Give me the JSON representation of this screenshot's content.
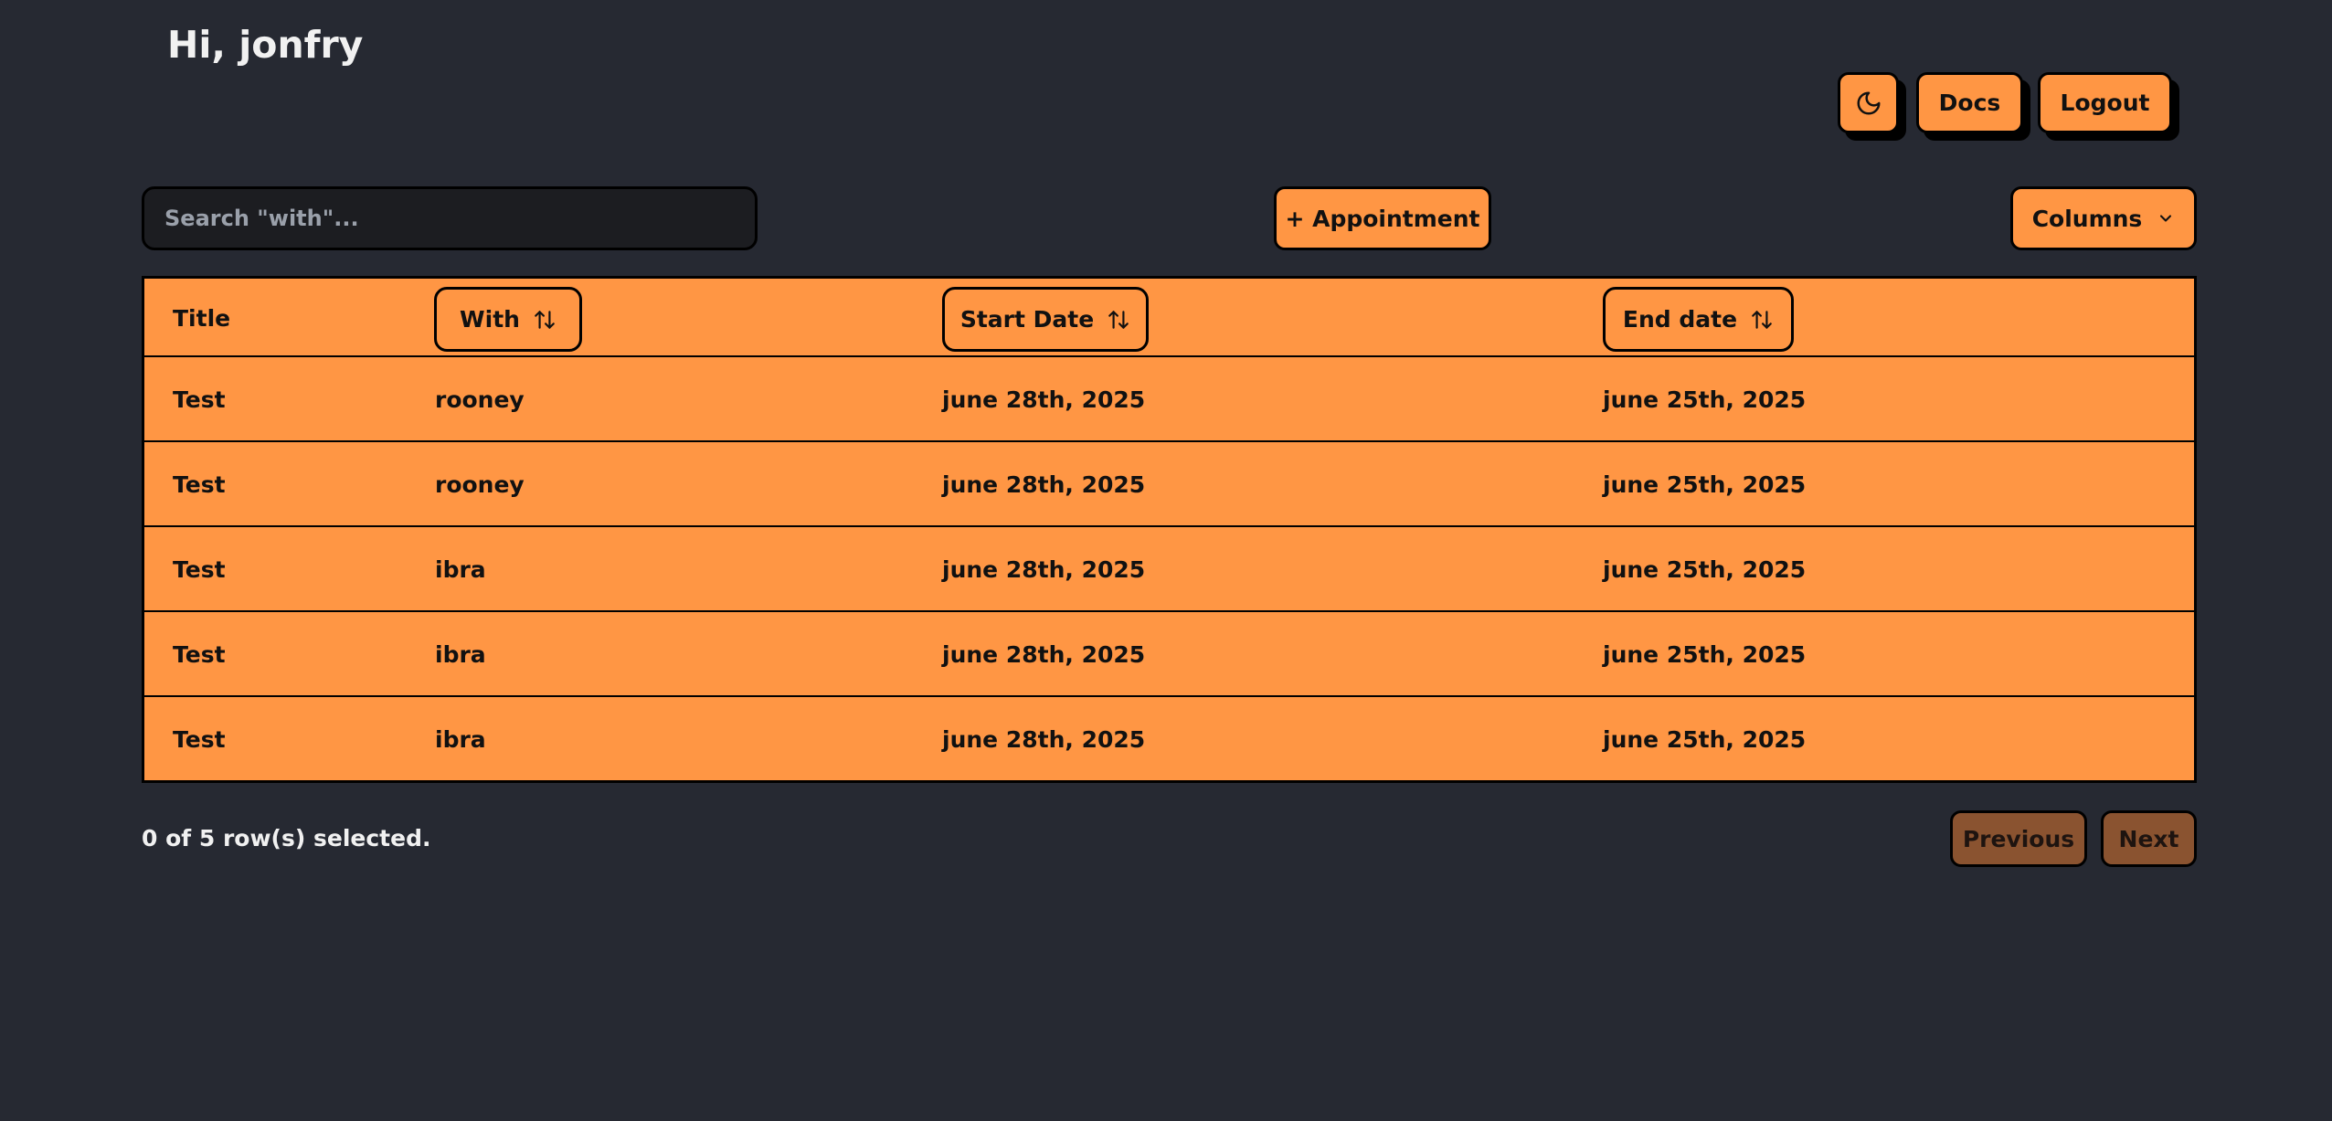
{
  "header": {
    "greeting": "Hi, jonfry",
    "theme_icon": "moon-icon",
    "docs_label": "Docs",
    "logout_label": "Logout"
  },
  "toolbar": {
    "search_placeholder": "Search \"with\"...",
    "search_value": "",
    "add_appointment_label": "+ Appointment",
    "columns_label": "Columns",
    "columns_icon": "chevron-down-icon"
  },
  "table": {
    "headers": {
      "title": "Title",
      "with": "With",
      "start_date": "Start Date",
      "end_date": "End date"
    },
    "sort_icon": "sort-arrows-icon",
    "rows": [
      {
        "title": "Test",
        "with": "rooney",
        "start_date": "june 28th, 2025",
        "end_date": "june 25th, 2025"
      },
      {
        "title": "Test",
        "with": "rooney",
        "start_date": "june 28th, 2025",
        "end_date": "june 25th, 2025"
      },
      {
        "title": "Test",
        "with": "ibra",
        "start_date": "june 28th, 2025",
        "end_date": "june 25th, 2025"
      },
      {
        "title": "Test",
        "with": "ibra",
        "start_date": "june 28th, 2025",
        "end_date": "june 25th, 2025"
      },
      {
        "title": "Test",
        "with": "ibra",
        "start_date": "june 28th, 2025",
        "end_date": "june 25th, 2025"
      }
    ]
  },
  "footer": {
    "selection_text": "0 of 5 row(s) selected.",
    "previous_label": "Previous",
    "next_label": "Next"
  },
  "colors": {
    "background": "#262932",
    "accent": "#ff9644",
    "disabled_button": "#8a5330",
    "border": "#000000"
  }
}
